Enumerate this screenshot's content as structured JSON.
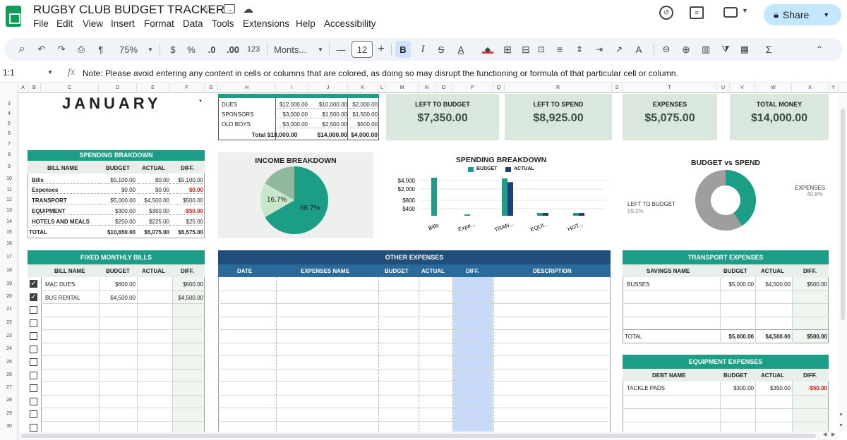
{
  "app": {
    "title": "RUGBY CLUB BUDGET TRACKER",
    "menu": [
      "File",
      "Edit",
      "View",
      "Insert",
      "Format",
      "Data",
      "Tools",
      "Extensions",
      "Help",
      "Accessibility"
    ],
    "share_label": "Share"
  },
  "toolbar": {
    "zoom": "75%",
    "currency": "$",
    "percent": "%",
    "dec_less": ".0",
    "dec_more": ".00",
    "number_format": "123",
    "font": "Monts...",
    "font_size": "12",
    "bold": "B",
    "italic": "I",
    "strike": "S",
    "text_color": "A"
  },
  "formula_bar": {
    "cell_ref": "1:1",
    "fx": "fx",
    "content": "Note: Please avoid entering any content in cells or columns that are colored, as doing so may disrupt the functioning or formula of that particular cell or column."
  },
  "columns": [
    "A",
    "B",
    "C",
    "D",
    "E",
    "F",
    "G",
    "H",
    "I",
    "J",
    "K",
    "L",
    "M",
    "N",
    "O",
    "P",
    "Q",
    "R",
    "S",
    "T",
    "U",
    "V",
    "W",
    "X",
    "Y"
  ],
  "rows": [
    "3",
    "4",
    "5",
    "6",
    "7",
    "8",
    "9",
    "10",
    "11",
    "12",
    "13",
    "14",
    "15",
    "16",
    "17",
    "18",
    "19",
    "20",
    "21",
    "22",
    "23",
    "24",
    "25",
    "26",
    "27",
    "28",
    "29",
    "30"
  ],
  "month": "JANUARY",
  "income": {
    "rows": [
      {
        "label": "DUES",
        "budget": "$12,000.00",
        "actual": "$10,000.00",
        "diff": "$2,000.00"
      },
      {
        "label": "SPONSORS",
        "budget": "$3,000.00",
        "actual": "$1,500.00",
        "diff": "$1,500.00"
      },
      {
        "label": "OLD BOYS",
        "budget": "$3,000.00",
        "actual": "$2,500.00",
        "diff": "$500.00"
      }
    ],
    "total_label": "Total",
    "total_budget": "$18,000.00",
    "total_actual": "$14,000.00",
    "total_diff": "$4,000.00"
  },
  "kpis": [
    {
      "label": "LEFT TO BUDGET",
      "value": "$7,350.00"
    },
    {
      "label": "LEFT TO SPEND",
      "value": "$8,925.00"
    },
    {
      "label": "EXPENSES",
      "value": "$5,075.00"
    },
    {
      "label": "TOTAL MONEY",
      "value": "$14,000.00"
    }
  ],
  "spending_breakdown": {
    "title": "SPENDING BRAKDOWN",
    "headers": [
      "BILL NAME",
      "BUDGET",
      "ACTUAL",
      "DIFF."
    ],
    "rows": [
      {
        "name": "Bills",
        "budget": "$5,100.00",
        "actual": "$0.00",
        "diff": "$5,100.00",
        "neg": false
      },
      {
        "name": "Expenses",
        "budget": "$0.00",
        "actual": "$0.00",
        "diff": "$0.00",
        "neg": true
      },
      {
        "name": "TRANSPORT",
        "budget": "$5,000.00",
        "actual": "$4,500.00",
        "diff": "$500.00",
        "neg": false
      },
      {
        "name": "EQUIPMENT",
        "budget": "$300.00",
        "actual": "$350.00",
        "diff": "-$50.00",
        "neg": true
      },
      {
        "name": "HOTELS AND MEALS",
        "budget": "$250.00",
        "actual": "$225.00",
        "diff": "$25.00",
        "neg": false
      }
    ],
    "total_label": "TOTAL",
    "total_budget": "$10,650.00",
    "total_actual": "$5,075.00",
    "total_diff": "$5,575.00"
  },
  "income_chart": {
    "title": "INCOME BREAKDOWN",
    "label_small": "16.7%",
    "label_large": "66.7%"
  },
  "chart_data": [
    {
      "type": "pie",
      "title": "INCOME BREAKDOWN",
      "categories": [
        "DUES",
        "SPONSORS",
        "OLD BOYS"
      ],
      "values": [
        66.7,
        16.7,
        16.7
      ],
      "colors": [
        "#1b9e85",
        "#c8e6c9",
        "#8fb89c"
      ]
    },
    {
      "type": "bar",
      "title": "SPENDING BREAKDOWN",
      "categories": [
        "Bills",
        "Expe...",
        "TRAN...",
        "EQUI...",
        "HOT..."
      ],
      "series": [
        {
          "name": "BUDGET",
          "values": [
            5100,
            0,
            5000,
            300,
            250
          ],
          "color": "#1b9e85"
        },
        {
          "name": "ACTUAL",
          "values": [
            0,
            0,
            4500,
            350,
            225
          ],
          "color": "#1f3f7a"
        }
      ],
      "yticks": [
        "$4,000",
        "$2,000",
        "$800",
        "$400"
      ],
      "legend": "top"
    },
    {
      "type": "pie",
      "title": "BUDGET vs SPEND",
      "categories": [
        "LEFT TO BUDGET",
        "EXPENSES"
      ],
      "values": [
        59.2,
        40.8
      ],
      "labels": [
        "59.2%",
        "40.8%"
      ],
      "colors": [
        "#9e9e9e",
        "#1b9e85"
      ]
    }
  ],
  "fixed_bills": {
    "title": "FIXED MONTHLY BILLS",
    "headers": [
      "BILL NAME",
      "BUDGET",
      "ACTUAL",
      "DIFF."
    ],
    "rows": [
      {
        "name": "MAC DUES",
        "budget": "$600.00",
        "actual": "",
        "diff": "$600.00",
        "checked": true
      },
      {
        "name": "BUS RENTAL",
        "budget": "$4,500.00",
        "actual": "",
        "diff": "$4,500.00",
        "checked": true
      }
    ]
  },
  "other_expenses": {
    "title": "OTHER EXPENSES",
    "headers": [
      "DATE",
      "EXPENSES NAME",
      "BUDGET",
      "ACTUAL",
      "DIFF.",
      "DESCRIPTION"
    ]
  },
  "transport": {
    "title": "TRANSPORT EXPENSES",
    "headers": [
      "SAVINGS NAME",
      "BUDGET",
      "ACTUAL",
      "DIFF."
    ],
    "rows": [
      {
        "name": "BUSSES",
        "budget": "$5,000.00",
        "actual": "$4,500.00",
        "diff": "$500.00"
      }
    ],
    "total_label": "TOTAL",
    "total_budget": "$5,000.00",
    "total_actual": "$4,500.00",
    "total_diff": "$500.00"
  },
  "equipment": {
    "title": "EQUIPMENT EXPENSES",
    "headers": [
      "DEBT NAME",
      "BUDGET",
      "ACTUAL",
      "DIFF."
    ],
    "rows": [
      {
        "name": "TACKLE PADS",
        "budget": "$300.00",
        "actual": "$350.00",
        "diff": "-$50.00"
      }
    ]
  }
}
